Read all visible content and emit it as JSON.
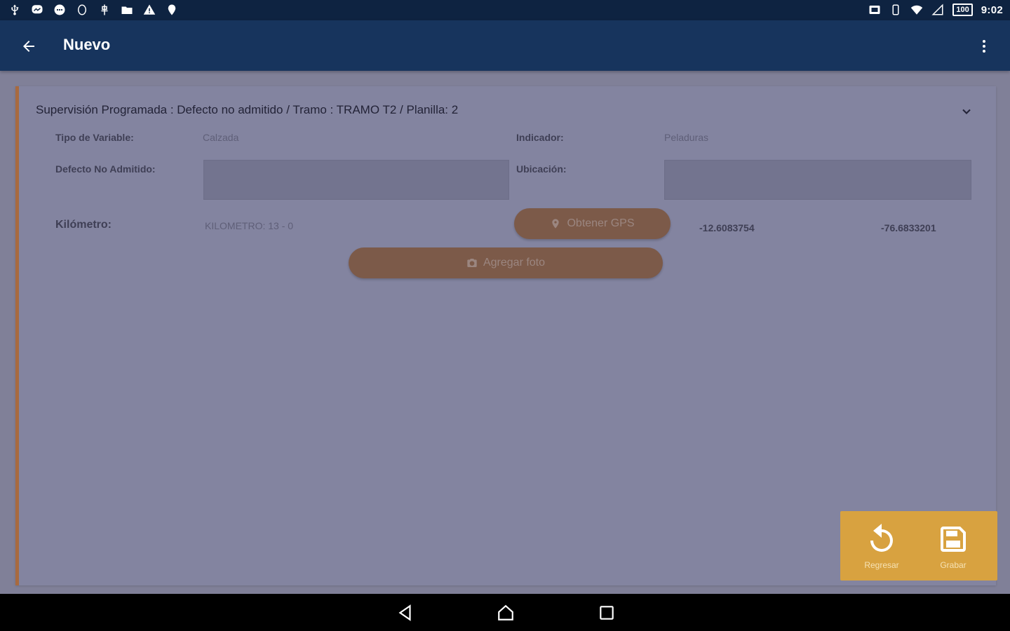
{
  "status_bar": {
    "left_icons": [
      "usb-icon",
      "messenger-icon",
      "chat-icon",
      "clock-icon",
      "usb-debug-icon",
      "folder-icon",
      "warning-icon",
      "location-pin-icon"
    ],
    "right_icons": [
      "cast-icon",
      "vibrate-icon",
      "wifi-icon",
      "signal-icon",
      "battery-icon"
    ],
    "battery_level": "100",
    "time": "9:02"
  },
  "app_bar": {
    "title": "Nuevo",
    "back_icon": "arrow-left-icon",
    "menu_icon": "more-vertical-icon"
  },
  "card": {
    "header": "Supervisión Programada : Defecto no admitido / Tramo : TRAMO T2 / Planilla: 2",
    "fields": {
      "tipo_variable_label": "Tipo de Variable:",
      "tipo_variable_value": "Calzada",
      "indicador_label": "Indicador:",
      "indicador_value": "Peladuras",
      "defecto_label": "Defecto No Admitido:",
      "defecto_value": "",
      "ubicacion_label": "Ubicación:",
      "ubicacion_value": "",
      "kilometro_label": "Kilómetro:",
      "kilometro_value": "KILOMETRO: 13 - 0",
      "latitude": "-12.6083754",
      "longitude": "-76.6833201"
    },
    "buttons": {
      "gps_label": "Obtener GPS",
      "photo_label": "Agregar foto"
    }
  },
  "actions": {
    "regresar_label": "Regresar",
    "grabar_label": "Grabar"
  },
  "colors": {
    "status_bar": "#0e2341",
    "app_bar": "#17345d",
    "accent_border": "#a86a3f",
    "pill_button": "#7c5a49",
    "action_panel": "#d8a240"
  }
}
